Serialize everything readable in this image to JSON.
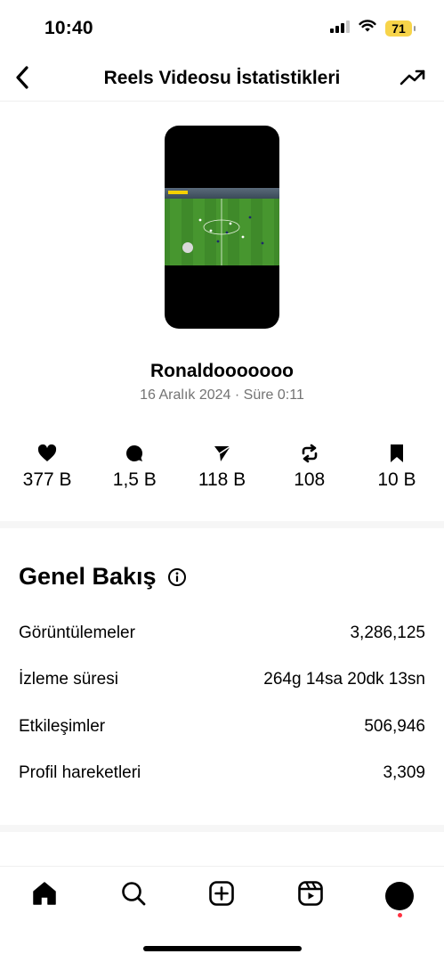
{
  "status_bar": {
    "time": "10:40",
    "battery": "71",
    "icons": [
      "signal-icon",
      "wifi-icon",
      "battery-icon"
    ]
  },
  "header": {
    "title": "Reels Videosu İstatistikleri",
    "back_icon": "chevron-left-icon",
    "action_icon": "trending-up-icon"
  },
  "reel": {
    "owner": "Ronaldooooooo",
    "meta": "16 Aralık 2024 · Süre 0:11"
  },
  "stats": [
    {
      "icon": "heart-icon",
      "value": "377 B"
    },
    {
      "icon": "comment-icon",
      "value": "1,5 B"
    },
    {
      "icon": "send-icon",
      "value": "118 B"
    },
    {
      "icon": "repost-icon",
      "value": "108"
    },
    {
      "icon": "bookmark-icon",
      "value": "10 B"
    }
  ],
  "overview": {
    "title": "Genel Bakış",
    "info_icon": "info-icon",
    "rows": [
      {
        "label": "Görüntülemeler",
        "value": "3,286,125"
      },
      {
        "label": "İzleme süresi",
        "value": "264g 14sa 20dk 13sn"
      },
      {
        "label": "Etkileşimler",
        "value": "506,946"
      },
      {
        "label": "Profil hareketleri",
        "value": "3,309"
      }
    ]
  },
  "bottom_nav": [
    "home-icon",
    "search-icon",
    "create-icon",
    "reels-icon",
    "profile-avatar"
  ],
  "colors": {
    "battery": "#f7d44a",
    "meta_text": "#737373",
    "notification_dot": "#ff3040",
    "field_green": "#3f8a2a"
  }
}
